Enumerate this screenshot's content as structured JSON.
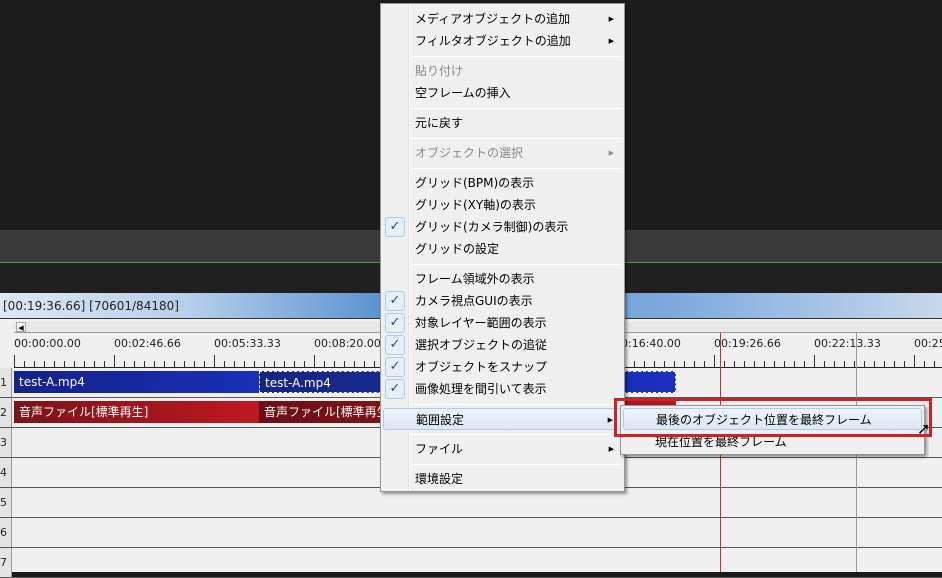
{
  "status": {
    "text": "[00:19:36.66] [70601/84180]"
  },
  "ruler": {
    "labels": [
      "00:00:00.00",
      "00:02:46.66",
      "00:05:33.33",
      "00:08:20.00",
      "00:16:40.00",
      "00:19:26.66",
      "00:22:13.33",
      "00:25"
    ]
  },
  "layers": [
    "1",
    "2",
    "3",
    "4",
    "5",
    "6",
    "7"
  ],
  "clips": {
    "video1": "test-A.mp4",
    "video2": "test-A.mp4",
    "audio1": "音声ファイル[標準再生]",
    "audio2": "音声ファイル[標準再生]"
  },
  "menu": {
    "items": [
      {
        "label": "メディアオブジェクトの追加",
        "submenu": true
      },
      {
        "label": "フィルタオブジェクトの追加",
        "submenu": true
      },
      {
        "label": "貼り付け",
        "disabled": true
      },
      {
        "label": "空フレームの挿入"
      },
      {
        "label": "元に戻す"
      },
      {
        "label": "オブジェクトの選択",
        "disabled": true,
        "submenu": true
      },
      {
        "label": "グリッド(BPM)の表示"
      },
      {
        "label": "グリッド(XY軸)の表示"
      },
      {
        "label": "グリッド(カメラ制御)の表示",
        "checked": true
      },
      {
        "label": "グリッドの設定"
      },
      {
        "label": "フレーム領域外の表示"
      },
      {
        "label": "カメラ視点GUIの表示",
        "checked": true
      },
      {
        "label": "対象レイヤー範囲の表示",
        "checked": true
      },
      {
        "label": "選択オブジェクトの追従",
        "checked": true
      },
      {
        "label": "オブジェクトをスナップ",
        "checked": true
      },
      {
        "label": "画像処理を間引いて表示",
        "checked": true
      },
      {
        "label": "範囲設定",
        "submenu": true,
        "highlighted": true
      },
      {
        "label": "ファイル",
        "submenu": true
      },
      {
        "label": "環境設定"
      }
    ]
  },
  "submenu": {
    "items": [
      {
        "label": "最後のオブジェクト位置を最終フレーム"
      },
      {
        "label": "現在位置を最終フレーム"
      }
    ]
  },
  "icons": {
    "check": "✓",
    "arrow": "▶",
    "scroll_left": "◀",
    "cursor": "mouse-pointer-icon"
  }
}
